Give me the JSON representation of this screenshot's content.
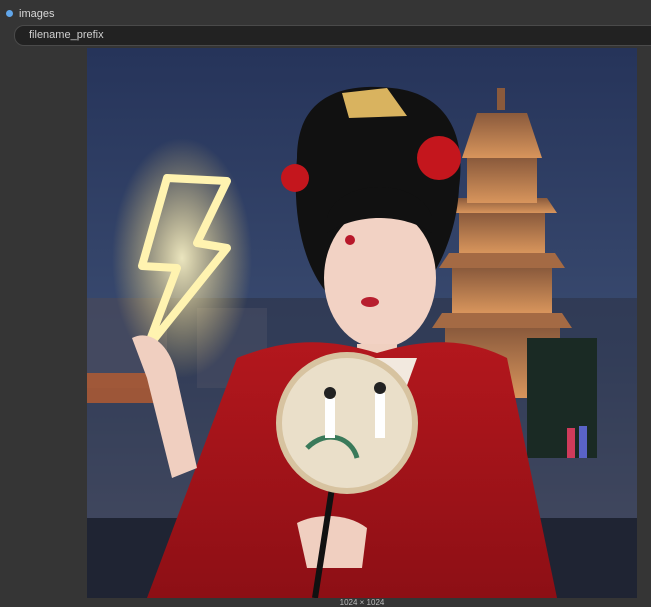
{
  "node": {
    "output_label": "images",
    "widget": {
      "label": "filename_prefix"
    },
    "preview": {
      "dimensions": "1024 × 1024"
    }
  },
  "colors": {
    "panel": "#353535",
    "widget_bg": "#222222",
    "output_dot": "#61a6ea"
  }
}
